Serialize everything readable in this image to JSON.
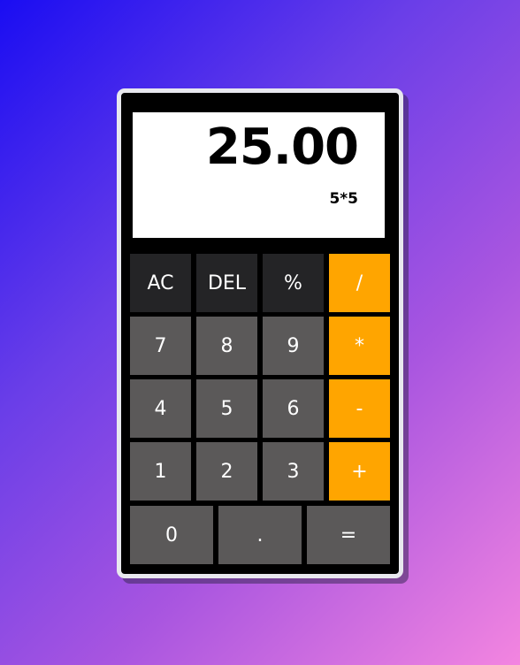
{
  "display": {
    "result": "25.00",
    "expression": "5*5"
  },
  "keys": {
    "ac": "AC",
    "del": "DEL",
    "percent": "%",
    "divide": "/",
    "seven": "7",
    "eight": "8",
    "nine": "9",
    "multiply": "*",
    "four": "4",
    "five": "5",
    "six": "6",
    "subtract": "-",
    "one": "1",
    "two": "2",
    "three": "3",
    "add": "+",
    "zero": "0",
    "decimal": ".",
    "equals": "="
  },
  "colors": {
    "operator": "#ffa500",
    "function_key": "#242426",
    "number_key": "#5b5959",
    "display_bg": "#ffffff",
    "body": "#000000"
  }
}
